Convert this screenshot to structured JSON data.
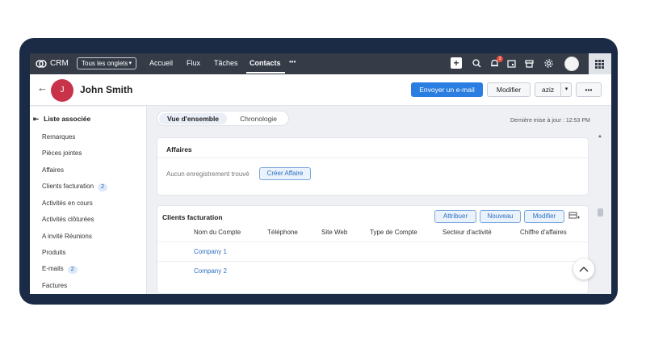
{
  "topbar": {
    "brand": "CRM",
    "tab_selector": "Tous les onglets",
    "nav": [
      "Accueil",
      "Flux",
      "Tâches",
      "Contacts"
    ],
    "active_nav": "Contacts",
    "more": "•••",
    "notification_count": "3",
    "icons": [
      "crm-logo-icon",
      "plus-icon",
      "search-icon",
      "bell-icon",
      "calendar-icon",
      "marketplace-icon",
      "gear-icon",
      "avatar",
      "apps-grid-icon"
    ]
  },
  "record": {
    "back": "←",
    "avatar_initial": "J",
    "name": "John Smith",
    "send_email": "Envoyer un e-mail",
    "edit": "Modifier",
    "owner": "aziz",
    "owner_caret": "▾",
    "more": "•••"
  },
  "sidebar": {
    "title": "Liste associée",
    "items": [
      {
        "label": "Remarques",
        "count": ""
      },
      {
        "label": "Pièces jointes",
        "count": ""
      },
      {
        "label": "Affaires",
        "count": ""
      },
      {
        "label": "Clients facturation",
        "count": "2"
      },
      {
        "label": "Activités en cours",
        "count": ""
      },
      {
        "label": "Activités clôturées",
        "count": ""
      },
      {
        "label": "A invité Réunions",
        "count": ""
      },
      {
        "label": "Produits",
        "count": ""
      },
      {
        "label": "E-mails",
        "count": "2"
      },
      {
        "label": "Factures",
        "count": ""
      }
    ]
  },
  "main": {
    "tabs": [
      "Vue d'ensemble",
      "Chronologie"
    ],
    "last_update": "Dernière mise à jour : 12:53 PM",
    "affaires": {
      "title": "Affaires",
      "empty": "Aucun enregistrement trouvé",
      "create": "Créer Affaire"
    },
    "clients": {
      "title": "Clients facturation",
      "buttons": [
        "Attribuer",
        "Nouveau",
        "Modifier"
      ],
      "columns": [
        "Nom du Compte",
        "Téléphone",
        "Site Web",
        "Type de Compte",
        "Secteur d'activité",
        "Chiffre d'affaires"
      ],
      "rows": [
        "Company 1",
        "Company 2"
      ]
    }
  },
  "colors": {
    "frame": "#1c2b45",
    "topbar": "#353c48",
    "primary": "#2a7de1",
    "avatar": "#c8334a",
    "badge": "#e94b3c"
  }
}
